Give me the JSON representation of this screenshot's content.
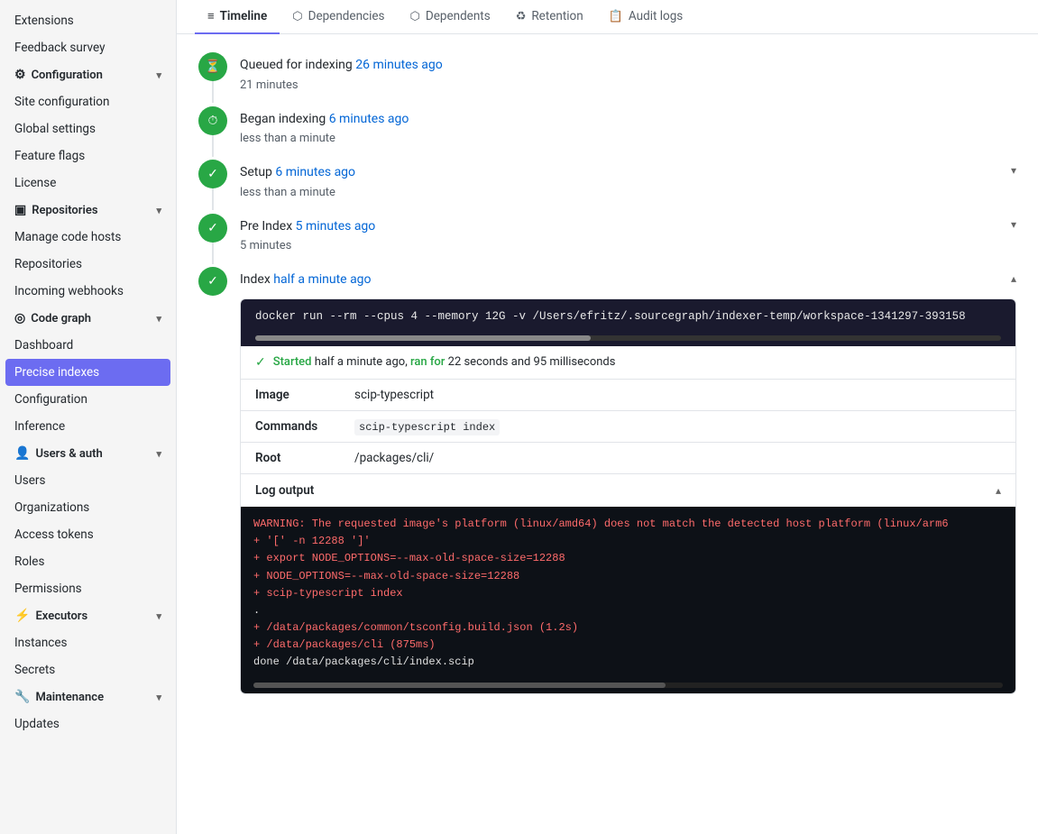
{
  "sidebar": {
    "items": [
      {
        "id": "extensions",
        "label": "Extensions",
        "type": "link"
      },
      {
        "id": "feedback-survey",
        "label": "Feedback survey",
        "type": "link"
      },
      {
        "id": "configuration-section",
        "label": "Configuration",
        "type": "section",
        "icon": "⚙"
      },
      {
        "id": "site-configuration",
        "label": "Site configuration",
        "type": "link"
      },
      {
        "id": "global-settings",
        "label": "Global settings",
        "type": "link"
      },
      {
        "id": "feature-flags",
        "label": "Feature flags",
        "type": "link"
      },
      {
        "id": "license",
        "label": "License",
        "type": "link"
      },
      {
        "id": "repositories-section",
        "label": "Repositories",
        "type": "section",
        "icon": "▣"
      },
      {
        "id": "manage-code-hosts",
        "label": "Manage code hosts",
        "type": "link"
      },
      {
        "id": "repositories",
        "label": "Repositories",
        "type": "link"
      },
      {
        "id": "incoming-webhooks",
        "label": "Incoming webhooks",
        "type": "link"
      },
      {
        "id": "code-graph-section",
        "label": "Code graph",
        "type": "section",
        "icon": "◎"
      },
      {
        "id": "dashboard",
        "label": "Dashboard",
        "type": "link"
      },
      {
        "id": "precise-indexes",
        "label": "Precise indexes",
        "type": "link",
        "active": true
      },
      {
        "id": "configuration",
        "label": "Configuration",
        "type": "link"
      },
      {
        "id": "inference",
        "label": "Inference",
        "type": "link"
      },
      {
        "id": "users-auth-section",
        "label": "Users & auth",
        "type": "section",
        "icon": "👤"
      },
      {
        "id": "users",
        "label": "Users",
        "type": "link"
      },
      {
        "id": "organizations",
        "label": "Organizations",
        "type": "link"
      },
      {
        "id": "access-tokens",
        "label": "Access tokens",
        "type": "link"
      },
      {
        "id": "roles",
        "label": "Roles",
        "type": "link"
      },
      {
        "id": "permissions",
        "label": "Permissions",
        "type": "link"
      },
      {
        "id": "executors-section",
        "label": "Executors",
        "type": "section",
        "icon": "⚡"
      },
      {
        "id": "instances",
        "label": "Instances",
        "type": "link"
      },
      {
        "id": "secrets",
        "label": "Secrets",
        "type": "link"
      },
      {
        "id": "maintenance-section",
        "label": "Maintenance",
        "type": "section",
        "icon": "🔧"
      },
      {
        "id": "updates",
        "label": "Updates",
        "type": "link"
      }
    ]
  },
  "tabs": [
    {
      "id": "timeline",
      "label": "Timeline",
      "icon": "≡",
      "active": true
    },
    {
      "id": "dependencies",
      "label": "Dependencies",
      "icon": "⬡"
    },
    {
      "id": "dependents",
      "label": "Dependents",
      "icon": "⬡"
    },
    {
      "id": "retention",
      "label": "Retention",
      "icon": "♻"
    },
    {
      "id": "audit-logs",
      "label": "Audit logs",
      "icon": "📋"
    }
  ],
  "timeline": {
    "items": [
      {
        "id": "queued",
        "icon": "⏳",
        "status": "queued",
        "title": "Queued for indexing",
        "time": "26 minutes ago",
        "duration": "21 minutes",
        "expanded": false
      },
      {
        "id": "began-indexing",
        "icon": "⏱",
        "status": "indexing",
        "title": "Began indexing",
        "time": "6 minutes ago",
        "duration": "less than a minute",
        "expanded": false
      },
      {
        "id": "setup",
        "icon": "✓",
        "status": "success",
        "title": "Setup",
        "time": "6 minutes ago",
        "duration": "less than a minute",
        "expanded": false,
        "hasChevron": true
      },
      {
        "id": "pre-index",
        "icon": "✓",
        "status": "success",
        "title": "Pre Index",
        "time": "5 minutes ago",
        "duration": "5 minutes",
        "expanded": false,
        "hasChevron": true
      },
      {
        "id": "index",
        "icon": "✓",
        "status": "success",
        "title": "Index",
        "time": "half a minute ago",
        "expanded": true,
        "hasChevron": true
      }
    ],
    "index_detail": {
      "command": "docker run --rm --cpus 4 --memory 12G -v /Users/efritz/.sourcegraph/indexer-temp/workspace-1341297-393158",
      "started_text": "Started half a minute ago, ran for 22 seconds and 95 milliseconds",
      "started_label": "Started",
      "ran_for_label": "ran for",
      "image_label": "Image",
      "image_value": "scip-typescript",
      "commands_label": "Commands",
      "commands_value": "scip-typescript index",
      "root_label": "Root",
      "root_value": "/packages/cli/",
      "log_output_label": "Log output",
      "log_lines": [
        "WARNING: The requested image's platform (linux/amd64) does not match the detected host platform (linux/arm6",
        "+ '[' -n 12288 ']'",
        "+ export NODE_OPTIONS=--max-old-space-size=12288",
        "+ NODE_OPTIONS=--max-old-space-size=12288",
        "+ scip-typescript index",
        ".",
        "+ /data/packages/common/tsconfig.build.json (1.2s)",
        "+ /data/packages/cli (875ms)",
        "done /data/packages/cli/index.scip"
      ]
    }
  }
}
